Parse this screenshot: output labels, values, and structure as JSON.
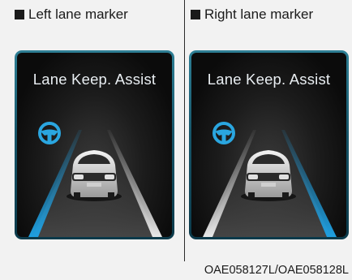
{
  "captions": {
    "left": "Left lane marker",
    "right": "Right lane marker"
  },
  "panels": {
    "left": {
      "title": "Lane Keep. Assist",
      "highlighted_lane": "left",
      "icon": "steering-wheel-icon"
    },
    "right": {
      "title": "Lane Keep. Assist",
      "highlighted_lane": "right",
      "icon": "steering-wheel-icon"
    }
  },
  "footer_code": "OAE058127L/OAE058128L",
  "colors": {
    "lane_highlight": "#1f9fe0",
    "lane_normal": "#d8d8d8",
    "icon": "#2aa6e0",
    "panel_border": "#2e7f95"
  }
}
